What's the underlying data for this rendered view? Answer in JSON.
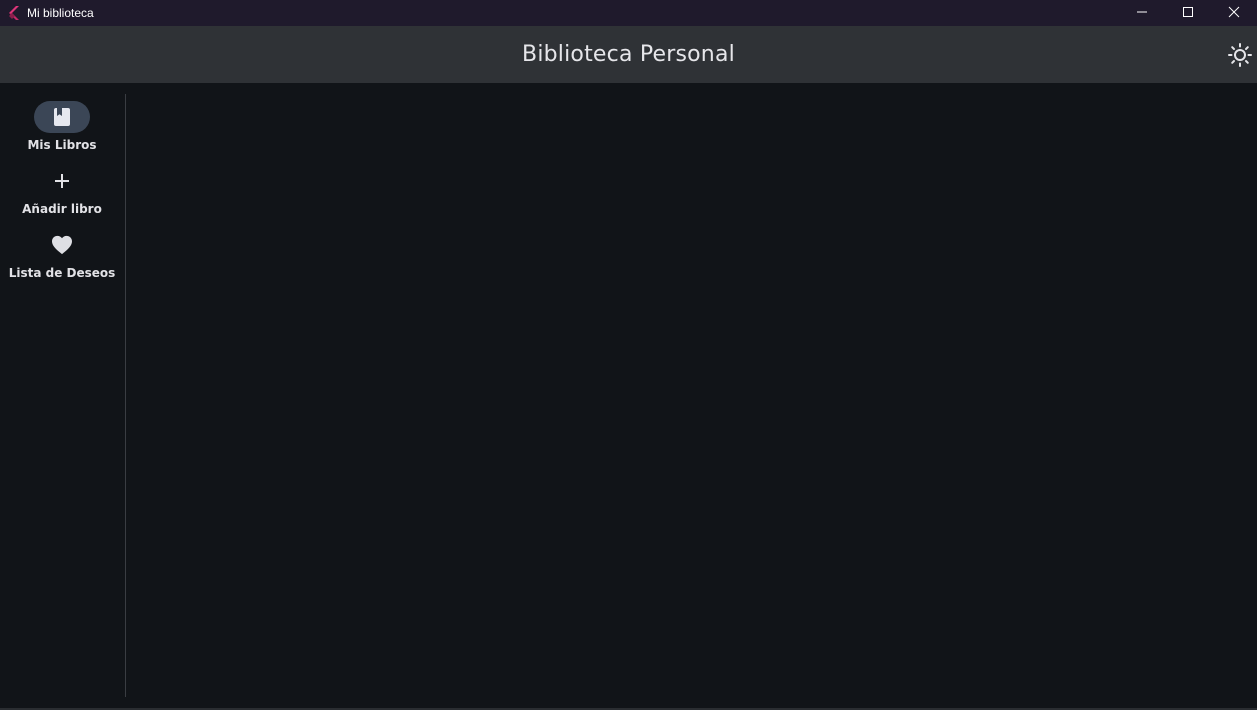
{
  "window": {
    "title": "Mi biblioteca"
  },
  "appbar": {
    "title": "Biblioteca Personal",
    "theme_icon": "sun-icon"
  },
  "navigation": {
    "items": [
      {
        "label": "Mis Libros",
        "icon": "book-icon",
        "selected": true
      },
      {
        "label": "Añadir libro",
        "icon": "plus-icon",
        "selected": false
      },
      {
        "label": "Lista de Deseos",
        "icon": "heart-icon",
        "selected": false
      }
    ]
  },
  "colors": {
    "titlebar": "#1f1a2c",
    "appbar": "#2f3236",
    "background": "#111418",
    "indicator": "#3b4656",
    "text": "#e2e2e6"
  }
}
